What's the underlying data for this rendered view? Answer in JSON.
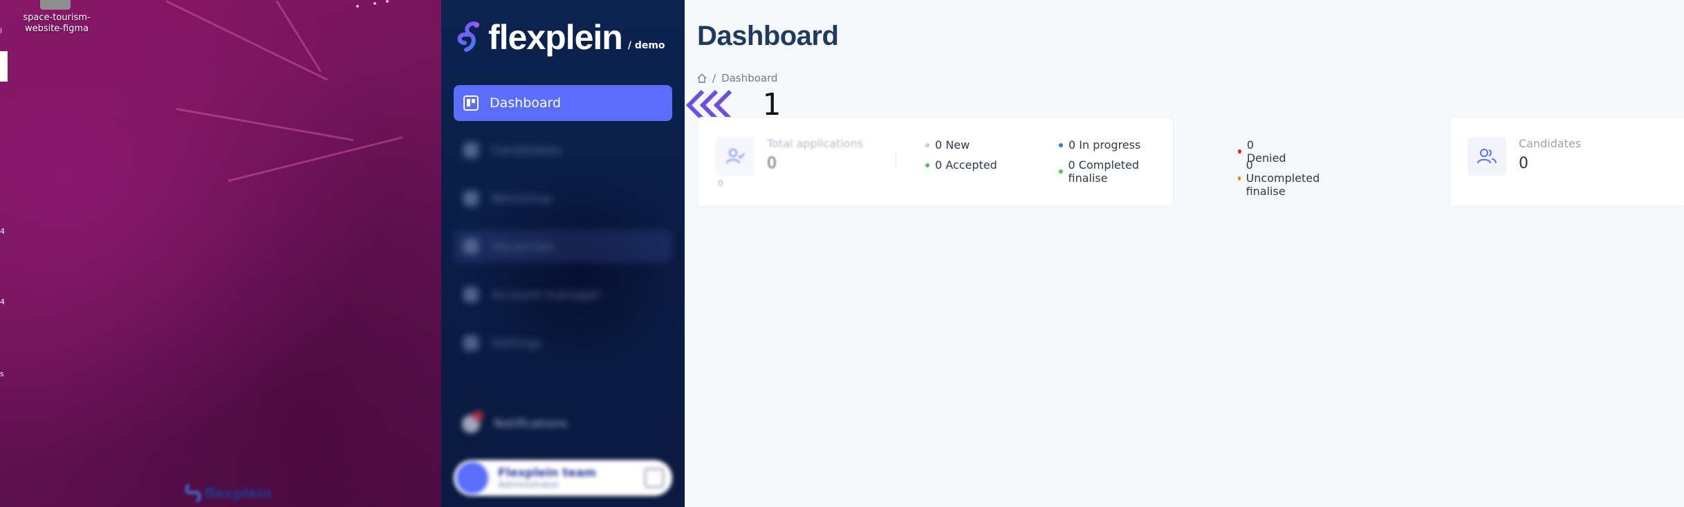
{
  "desktop": {
    "icon_label": "space-tourism-website-figma",
    "edge_fragments": [
      "i",
      "4",
      "4",
      "s"
    ],
    "dock_app": "flexplein"
  },
  "sidebar": {
    "brand": "flexplein",
    "brand_suffix": "/ demo",
    "nav_active": {
      "label": "Dashboard",
      "icon": "board-icon"
    },
    "nav_items": [
      {
        "label": "Candidates",
        "icon": "user-icon"
      },
      {
        "label": "Workshop",
        "icon": "doc-icon"
      },
      {
        "label": "Vacancies",
        "icon": "board-icon"
      },
      {
        "label": "Account manager",
        "icon": "user-gear-icon"
      },
      {
        "label": "Settings",
        "icon": "gear-icon"
      }
    ],
    "notifications_label": "Notifications",
    "user": {
      "name": "Flexplein team",
      "role": "Administrator"
    },
    "colors": {
      "bg": "#0b1f4a",
      "accent": "#5a6dfb"
    }
  },
  "main": {
    "title": "Dashboard",
    "breadcrumb": {
      "current": "Dashboard"
    },
    "callout_number": "1",
    "cards": {
      "applications": {
        "label": "Total applications",
        "value": "0",
        "small_value": "0",
        "stats": [
          {
            "text": "0 New",
            "color": "#c9ccd4"
          },
          {
            "text": "0 Accepted",
            "color": "#4cc552"
          },
          {
            "text": "0 In progress",
            "color": "#2f74e8"
          },
          {
            "text": "0 Completed finalise",
            "color": "#4cc552"
          },
          {
            "text": "0 Denied",
            "color": "#e0261c"
          },
          {
            "text": "0 Uncompleted finalise",
            "color": "#f07d10"
          }
        ]
      },
      "candidates": {
        "label": "Candidates",
        "value": "0"
      }
    }
  }
}
